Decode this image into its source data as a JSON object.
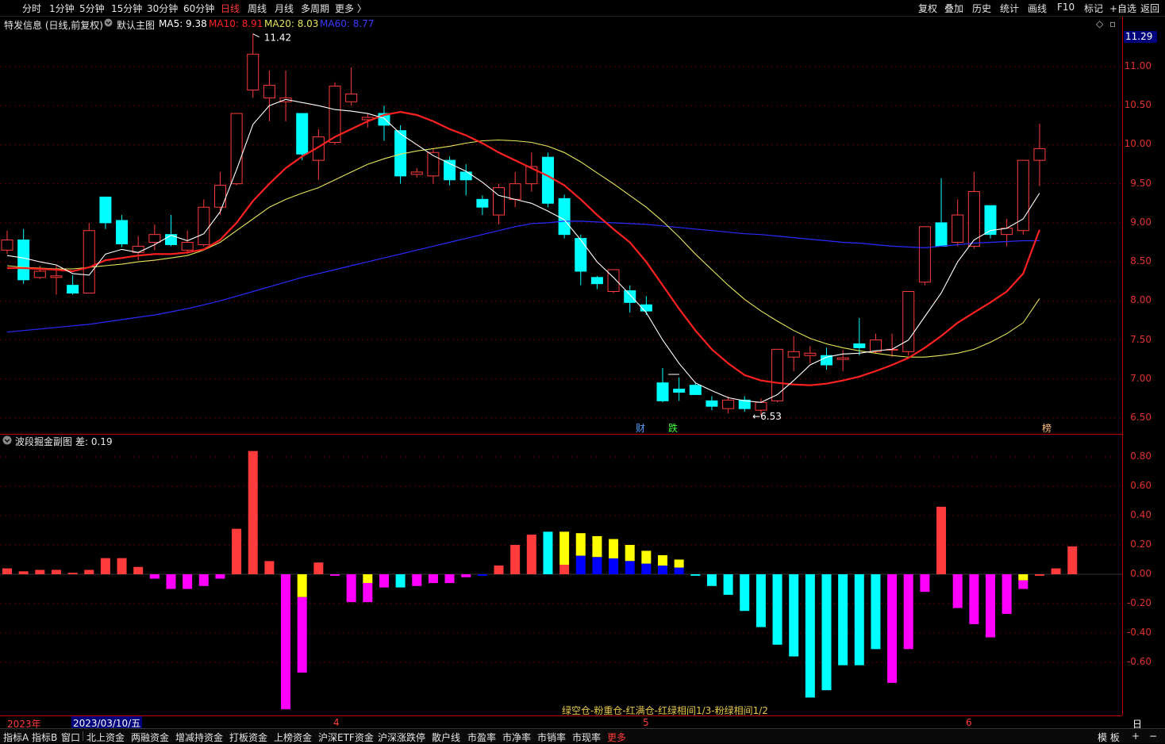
{
  "topbar": {
    "periods": [
      "分时",
      "1分钟",
      "5分钟",
      "15分钟",
      "30分钟",
      "60分钟",
      "日线",
      "周线",
      "月线",
      "多周期",
      "更多 〉"
    ],
    "active_period": "日线",
    "tools": [
      "复权",
      "叠加",
      "历史",
      "统计",
      "画线",
      "F10",
      "标记",
      "+自选",
      "返回"
    ]
  },
  "info": {
    "stock": "特发信息 (日线,前复权)",
    "template": "默认主图",
    "ma5": "MA5: 9.38",
    "ma10": "MA10: 8.91",
    "ma20": "MA20: 8.03",
    "ma60": "MA60: 8.77",
    "current_price": "11.29"
  },
  "sub": {
    "title": "波段掘金副图",
    "value": "差: 0.19",
    "legend": "绿空仓-粉重仓-红满仓-红绿相间1/3-粉绿相间1/2"
  },
  "markers": {
    "high": "11.42",
    "low": "6.53",
    "m1": "财",
    "m2": "跌",
    "m3": "榜"
  },
  "axis": {
    "main_ticks": [
      "11.00",
      "10.50",
      "10.00",
      "9.50",
      "9.00",
      "8.50",
      "8.00",
      "7.50",
      "7.00",
      "6.50"
    ],
    "sub_ticks": [
      "0.80",
      "0.60",
      "0.40",
      "0.20",
      "0.00",
      "-0.20",
      "-0.40",
      "-0.60"
    ]
  },
  "dates": {
    "year": "2023年",
    "cursor": "2023/03/10/五",
    "m4": "4",
    "m5": "5",
    "m6": "6",
    "period": "日线"
  },
  "bottombar": {
    "items": [
      "指标A",
      "指标B",
      "窗口",
      "北上资金",
      "两融资金",
      "增减持资金",
      "打板资金",
      "上榜资金",
      "沪深ETF资金",
      "沪深涨跌停",
      "散户线",
      "市盈率",
      "市净率",
      "市销率",
      "市现率",
      "更多"
    ],
    "right": [
      "模 板",
      "+",
      "−"
    ]
  },
  "colors": {
    "up": "#ff3b3b",
    "down": "#00ffff",
    "ma5": "#ffffff",
    "ma10": "#ff2020",
    "ma20": "#e6e65a",
    "ma60": "#2a2aff",
    "pink": "#ff00ff",
    "yellow": "#ffff00",
    "blue": "#0000ff"
  },
  "chart_data": {
    "type": "candlestick",
    "ylim": [
      6.4,
      11.6
    ],
    "candles": [
      {
        "o": 8.65,
        "c": 8.78,
        "h": 8.9,
        "l": 8.6
      },
      {
        "o": 8.78,
        "c": 8.27,
        "h": 8.92,
        "l": 8.22
      },
      {
        "o": 8.3,
        "c": 8.38,
        "h": 8.45,
        "l": 8.28
      },
      {
        "o": 8.3,
        "c": 8.32,
        "h": 8.45,
        "l": 8.08
      },
      {
        "o": 8.2,
        "c": 8.1,
        "h": 8.33,
        "l": 8.08
      },
      {
        "o": 8.1,
        "c": 8.9,
        "h": 9.0,
        "l": 8.1
      },
      {
        "o": 9.33,
        "c": 9.0,
        "h": 9.33,
        "l": 8.92
      },
      {
        "o": 9.03,
        "c": 8.73,
        "h": 9.1,
        "l": 8.69
      },
      {
        "o": 8.62,
        "c": 8.7,
        "h": 8.83,
        "l": 8.52
      },
      {
        "o": 8.75,
        "c": 8.85,
        "h": 8.98,
        "l": 8.65
      },
      {
        "o": 8.85,
        "c": 8.72,
        "h": 9.1,
        "l": 8.7
      },
      {
        "o": 8.65,
        "c": 8.75,
        "h": 8.9,
        "l": 8.6
      },
      {
        "o": 8.72,
        "c": 9.2,
        "h": 9.3,
        "l": 8.7
      },
      {
        "o": 9.2,
        "c": 9.48,
        "h": 9.65,
        "l": 9.1
      },
      {
        "o": 9.5,
        "c": 10.4,
        "h": 10.4,
        "l": 9.48
      },
      {
        "o": 10.7,
        "c": 11.16,
        "h": 11.42,
        "l": 10.6
      },
      {
        "o": 10.6,
        "c": 10.76,
        "h": 10.95,
        "l": 10.3
      },
      {
        "o": 10.55,
        "c": 10.6,
        "h": 10.95,
        "l": 10.3
      },
      {
        "o": 10.4,
        "c": 9.88,
        "h": 10.4,
        "l": 9.8
      },
      {
        "o": 9.8,
        "c": 10.1,
        "h": 10.2,
        "l": 9.55
      },
      {
        "o": 10.03,
        "c": 10.75,
        "h": 10.8,
        "l": 10.0
      },
      {
        "o": 10.55,
        "c": 10.65,
        "h": 10.99,
        "l": 10.5
      },
      {
        "o": 10.32,
        "c": 10.35,
        "h": 10.4,
        "l": 10.22
      },
      {
        "o": 10.4,
        "c": 10.25,
        "h": 10.5,
        "l": 10.05
      },
      {
        "o": 10.18,
        "c": 9.6,
        "h": 10.25,
        "l": 9.5
      },
      {
        "o": 9.62,
        "c": 9.65,
        "h": 9.7,
        "l": 9.58
      },
      {
        "o": 9.6,
        "c": 9.9,
        "h": 9.95,
        "l": 9.5
      },
      {
        "o": 9.8,
        "c": 9.55,
        "h": 9.85,
        "l": 9.48
      },
      {
        "o": 9.65,
        "c": 9.55,
        "h": 9.75,
        "l": 9.35
      },
      {
        "o": 9.3,
        "c": 9.2,
        "h": 9.35,
        "l": 9.1
      },
      {
        "o": 9.1,
        "c": 9.45,
        "h": 9.5,
        "l": 8.98
      },
      {
        "o": 9.3,
        "c": 9.5,
        "h": 9.65,
        "l": 9.2
      },
      {
        "o": 9.5,
        "c": 9.72,
        "h": 9.9,
        "l": 9.4
      },
      {
        "o": 9.84,
        "c": 9.25,
        "h": 9.9,
        "l": 9.2
      },
      {
        "o": 9.31,
        "c": 8.85,
        "h": 9.36,
        "l": 8.8
      },
      {
        "o": 8.8,
        "c": 8.38,
        "h": 8.85,
        "l": 8.2
      },
      {
        "o": 8.3,
        "c": 8.22,
        "h": 8.32,
        "l": 8.15
      },
      {
        "o": 8.12,
        "c": 8.4,
        "h": 8.4,
        "l": 8.1
      },
      {
        "o": 8.13,
        "c": 7.98,
        "h": 8.2,
        "l": 7.85
      },
      {
        "o": 7.95,
        "c": 7.87,
        "h": 8.06,
        "l": 7.82
      },
      {
        "o": 6.95,
        "c": 6.72,
        "h": 7.14,
        "l": 6.7
      },
      {
        "o": 6.87,
        "c": 6.83,
        "h": 7.02,
        "l": 6.72
      },
      {
        "o": 6.92,
        "c": 6.8,
        "h": 6.96,
        "l": 6.8
      },
      {
        "o": 6.72,
        "c": 6.65,
        "h": 6.78,
        "l": 6.6
      },
      {
        "o": 6.62,
        "c": 6.73,
        "h": 6.78,
        "l": 6.56
      },
      {
        "o": 6.73,
        "c": 6.62,
        "h": 6.78,
        "l": 6.58
      },
      {
        "o": 6.6,
        "c": 6.7,
        "h": 6.75,
        "l": 6.53
      },
      {
        "o": 6.72,
        "c": 7.38,
        "h": 7.38,
        "l": 6.7
      },
      {
        "o": 7.28,
        "c": 7.35,
        "h": 7.55,
        "l": 7.1
      },
      {
        "o": 7.3,
        "c": 7.33,
        "h": 7.42,
        "l": 7.2
      },
      {
        "o": 7.3,
        "c": 7.18,
        "h": 7.4,
        "l": 7.12
      },
      {
        "o": 7.25,
        "c": 7.27,
        "h": 7.37,
        "l": 7.1
      },
      {
        "o": 7.45,
        "c": 7.4,
        "h": 7.78,
        "l": 7.3
      },
      {
        "o": 7.35,
        "c": 7.5,
        "h": 7.58,
        "l": 7.33
      },
      {
        "o": 7.38,
        "c": 7.38,
        "h": 7.58,
        "l": 7.28
      },
      {
        "o": 7.35,
        "c": 8.12,
        "h": 8.12,
        "l": 7.3
      },
      {
        "o": 8.24,
        "c": 8.95,
        "h": 8.95,
        "l": 8.2
      },
      {
        "o": 9.0,
        "c": 8.7,
        "h": 9.57,
        "l": 8.7
      },
      {
        "o": 8.75,
        "c": 9.1,
        "h": 9.3,
        "l": 8.7
      },
      {
        "o": 8.7,
        "c": 9.4,
        "h": 9.65,
        "l": 8.67
      },
      {
        "o": 9.22,
        "c": 8.85,
        "h": 9.22,
        "l": 8.8
      },
      {
        "o": 8.85,
        "c": 8.93,
        "h": 9.05,
        "l": 8.7
      },
      {
        "o": 8.9,
        "c": 9.8,
        "h": 9.8,
        "l": 8.85
      },
      {
        "o": 9.8,
        "c": 9.95,
        "h": 10.27,
        "l": 9.47
      }
    ],
    "ma5": [
      8.58,
      8.55,
      8.5,
      8.46,
      8.35,
      8.33,
      8.6,
      8.66,
      8.62,
      8.72,
      8.84,
      8.77,
      8.86,
      9.14,
      9.68,
      10.26,
      10.5,
      10.58,
      10.54,
      10.5,
      10.45,
      10.43,
      10.4,
      10.34,
      10.14,
      10.0,
      9.86,
      9.76,
      9.66,
      9.52,
      9.35,
      9.3,
      9.25,
      9.15,
      9.04,
      8.78,
      8.5,
      8.3,
      8.08,
      7.85,
      7.5,
      7.2,
      6.95,
      6.85,
      6.76,
      6.72,
      6.7,
      6.8,
      6.98,
      7.18,
      7.28,
      7.32,
      7.33,
      7.36,
      7.38,
      7.5,
      7.8,
      8.1,
      8.5,
      8.78,
      8.9,
      8.93,
      9.05,
      9.38
    ],
    "ma10": [
      8.42,
      8.42,
      8.41,
      8.4,
      8.38,
      8.43,
      8.52,
      8.55,
      8.58,
      8.6,
      8.6,
      8.62,
      8.66,
      8.78,
      9.0,
      9.28,
      9.5,
      9.7,
      9.85,
      9.97,
      10.1,
      10.2,
      10.3,
      10.38,
      10.42,
      10.38,
      10.3,
      10.2,
      10.12,
      10.02,
      9.9,
      9.8,
      9.7,
      9.6,
      9.48,
      9.3,
      9.1,
      8.92,
      8.75,
      8.5,
      8.2,
      7.9,
      7.62,
      7.38,
      7.2,
      7.05,
      6.98,
      6.95,
      6.93,
      6.92,
      6.94,
      6.98,
      7.03,
      7.1,
      7.18,
      7.27,
      7.4,
      7.55,
      7.72,
      7.85,
      7.98,
      8.12,
      8.35,
      8.91
    ],
    "ma20": [
      8.45,
      8.43,
      8.42,
      8.41,
      8.41,
      8.43,
      8.45,
      8.47,
      8.5,
      8.52,
      8.55,
      8.58,
      8.65,
      8.75,
      8.9,
      9.05,
      9.2,
      9.3,
      9.38,
      9.45,
      9.55,
      9.65,
      9.75,
      9.82,
      9.88,
      9.92,
      9.95,
      9.98,
      10.02,
      10.05,
      10.06,
      10.05,
      10.03,
      9.98,
      9.9,
      9.78,
      9.64,
      9.5,
      9.35,
      9.2,
      9.02,
      8.82,
      8.6,
      8.4,
      8.2,
      8.02,
      7.87,
      7.74,
      7.62,
      7.52,
      7.45,
      7.4,
      7.36,
      7.33,
      7.3,
      7.28,
      7.28,
      7.3,
      7.33,
      7.38,
      7.47,
      7.58,
      7.72,
      8.03
    ],
    "ma60": [
      7.6,
      7.62,
      7.64,
      7.66,
      7.68,
      7.7,
      7.73,
      7.76,
      7.79,
      7.82,
      7.86,
      7.9,
      7.95,
      8.0,
      8.06,
      8.12,
      8.18,
      8.24,
      8.3,
      8.35,
      8.4,
      8.45,
      8.5,
      8.55,
      8.6,
      8.65,
      8.7,
      8.75,
      8.8,
      8.85,
      8.9,
      8.95,
      8.99,
      9.0,
      9.02,
      9.02,
      9.01,
      9.0,
      8.99,
      8.98,
      8.96,
      8.94,
      8.92,
      8.9,
      8.88,
      8.86,
      8.85,
      8.83,
      8.81,
      8.79,
      8.77,
      8.75,
      8.74,
      8.72,
      8.7,
      8.69,
      8.68,
      8.7,
      8.72,
      8.74,
      8.75,
      8.76,
      8.77,
      8.77
    ],
    "sub": {
      "ylim": [
        -0.93,
        0.93
      ],
      "bars": [
        {
          "v": 0.04,
          "t": "red"
        },
        {
          "v": 0.02,
          "t": "red"
        },
        {
          "v": 0.03,
          "t": "red"
        },
        {
          "v": 0.03,
          "t": "red"
        },
        {
          "v": 0.01,
          "t": "red"
        },
        {
          "v": 0.03,
          "t": "red"
        },
        {
          "v": 0.11,
          "t": "red"
        },
        {
          "v": 0.11,
          "t": "red"
        },
        {
          "v": 0.05,
          "t": "red"
        },
        {
          "v": -0.03,
          "t": "pink"
        },
        {
          "v": -0.1,
          "t": "pink"
        },
        {
          "v": -0.1,
          "t": "pink"
        },
        {
          "v": -0.08,
          "t": "pink"
        },
        {
          "v": -0.03,
          "t": "pink"
        },
        {
          "v": 0.31,
          "t": "red"
        },
        {
          "v": 0.84,
          "t": "red"
        },
        {
          "v": 0.09,
          "t": "red"
        },
        {
          "v": -0.92,
          "t": "pink"
        },
        {
          "v": -0.67,
          "t": "pinkyellow"
        },
        {
          "v": 0.08,
          "t": "red"
        },
        {
          "v": -0.01,
          "t": "pink"
        },
        {
          "v": -0.19,
          "t": "pink"
        },
        {
          "v": -0.19,
          "t": "pinkyellow"
        },
        {
          "v": -0.09,
          "t": "pink"
        },
        {
          "v": -0.09,
          "t": "cyan"
        },
        {
          "v": -0.08,
          "t": "pink"
        },
        {
          "v": -0.06,
          "t": "pink"
        },
        {
          "v": -0.06,
          "t": "pink"
        },
        {
          "v": -0.02,
          "t": "pink"
        },
        {
          "v": -0.01,
          "t": "blue"
        },
        {
          "v": 0.06,
          "t": "red"
        },
        {
          "v": 0.2,
          "t": "red"
        },
        {
          "v": 0.27,
          "t": "red"
        },
        {
          "v": 0.29,
          "t": "cyan"
        },
        {
          "v": 0.29,
          "t": "redyellow"
        },
        {
          "v": 0.28,
          "t": "blueyellow"
        },
        {
          "v": 0.26,
          "t": "blueyellow"
        },
        {
          "v": 0.24,
          "t": "blueyellow"
        },
        {
          "v": 0.2,
          "t": "blueyellow"
        },
        {
          "v": 0.16,
          "t": "blueyellow"
        },
        {
          "v": 0.13,
          "t": "blueyellow"
        },
        {
          "v": 0.1,
          "t": "blueyellow"
        },
        {
          "v": -0.01,
          "t": "cyan"
        },
        {
          "v": -0.08,
          "t": "cyan"
        },
        {
          "v": -0.14,
          "t": "cyan"
        },
        {
          "v": -0.25,
          "t": "cyan"
        },
        {
          "v": -0.36,
          "t": "cyan"
        },
        {
          "v": -0.48,
          "t": "cyan"
        },
        {
          "v": -0.56,
          "t": "cyan"
        },
        {
          "v": -0.84,
          "t": "cyan"
        },
        {
          "v": -0.79,
          "t": "cyan"
        },
        {
          "v": -0.62,
          "t": "cyan"
        },
        {
          "v": -0.62,
          "t": "cyan"
        },
        {
          "v": -0.51,
          "t": "cyan"
        },
        {
          "v": -0.74,
          "t": "pink"
        },
        {
          "v": -0.51,
          "t": "pink"
        },
        {
          "v": -0.12,
          "t": "pink"
        },
        {
          "v": 0.46,
          "t": "red"
        },
        {
          "v": -0.23,
          "t": "pink"
        },
        {
          "v": -0.34,
          "t": "pink"
        },
        {
          "v": -0.43,
          "t": "pink"
        },
        {
          "v": -0.27,
          "t": "pink"
        },
        {
          "v": -0.1,
          "t": "pinkyellow"
        },
        {
          "v": -0.01,
          "t": "red"
        },
        {
          "v": 0.04,
          "t": "red"
        },
        {
          "v": 0.19,
          "t": "red"
        }
      ]
    }
  }
}
